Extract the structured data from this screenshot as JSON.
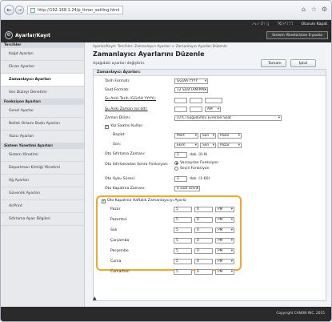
{
  "browser": {
    "url": "http://192.168.1.24/p_timer_setting.html"
  },
  "header": {
    "user_label": "Ana Giriş",
    "logout_label": "Oturum Açan Kullanıcı:",
    "user_id": "7654321",
    "logout": "Oturum Kapat",
    "title": "Ayarlar/Kayıt",
    "mail_button": "Sistem Yöneticisine E-posta"
  },
  "sidebar": {
    "sections": [
      {
        "title": "Tercihler",
        "items": [
          "Kağıt Ayarları",
          "Ekran Ayarları",
          "Zamanlayıcı Ayarları",
          "Ses Düzeyi Denetimi"
        ]
      },
      {
        "title": "Fonksiyon Ayarları",
        "items": [
          "Genel Ayarlar",
          "Bellek Ortamı Baskı Ayarları",
          "Yazıcı Ayarları"
        ]
      },
      {
        "title": "Sistem Yönetimi Ayarları",
        "items": [
          "Sistem Yönetimi",
          "Departman Kimliği Yönetimi",
          "Ağ Ayarları",
          "Güvenlik Ayarları",
          "AirPrint",
          "Sıfırlama Ayarı Bilgileri"
        ]
      }
    ],
    "active": "Zamanlayıcı Ayarları"
  },
  "main": {
    "breadcrumb": "Ayarlar/Kayıt: Tercihler: Zamanlayıcı Ayarları > Zamanlayıcı Ayarları Düzenle",
    "title": "Zamanlayıcı Ayarlarını Düzenle",
    "note": "Aşağıdaki ayarları değiştirin.",
    "ok_button": "Tamam",
    "cancel_button": "İptal",
    "panel_title": "Zamanlayıcı Ayarları:",
    "date_format_label": "Tarih Formatı:",
    "date_format_value": "GG/AA YYYY",
    "time_format_label": "Saat Formatı:",
    "time_format_value": "12 Saat (AM/PM)",
    "current_date_label": "Şu Anki Tarih (GG/AA YYYY):",
    "current_time_label": "Şu Anki Zaman (ss:dd):",
    "current_time_ampm": "AM",
    "timezone_label": "Zaman Dilimi:",
    "timezone_value": "(UTC) Eşgüdümlü Evrensel Saat",
    "dst_label": "Yaz Saatini Kullan",
    "dst_start_label": "Başlat:",
    "dst_start": [
      "Mart",
      "Son",
      "Pazar"
    ],
    "dst_end_label": "Son:",
    "dst_end": [
      "Ekim",
      "Son",
      "Pazar"
    ],
    "auto_reset_label": "Oto Sıfırlama Zamanı:",
    "auto_reset_value": "2",
    "auto_reset_unit": "dak. (0-9)",
    "after_reset_label": "Oto Sıfırlamadan Sonra Fonksiyon:",
    "after_reset_opt1": "Varsayılan Fonksiyon",
    "after_reset_opt2": "Seçili Fonksiyon",
    "sleep_label": "Oto Uyku Süresi:",
    "sleep_value": "3",
    "sleep_unit": "dak. (1-60)",
    "shutdown_label": "Oto Kapatma Zamanı:",
    "shutdown_value": "4 saat sonra",
    "weekly_label": "Oto Kapatma Haftalık Zamanlayıcıyı Ayarla",
    "days": [
      "Pazar",
      "Pazartesi",
      "Salı",
      "Çarşamba",
      "Perşembe",
      "Cuma",
      "Cumartesi"
    ],
    "day_hour": "5",
    "day_minute": "0",
    "day_ampm": "PM"
  },
  "footer": {
    "copyright": "Copyright CANON INC. 2015"
  }
}
